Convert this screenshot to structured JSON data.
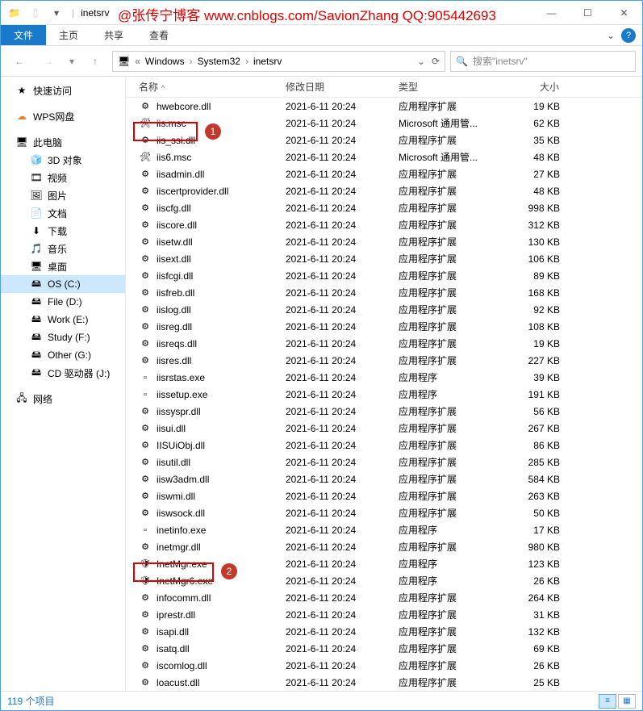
{
  "watermark": "@张传宁博客 www.cnblogs.com/SavionZhang  QQ:905442693",
  "window": {
    "title": "inetsrv"
  },
  "tabs": {
    "file": "文件",
    "home": "主页",
    "share": "共享",
    "view": "查看"
  },
  "breadcrumbs": [
    "Windows",
    "System32",
    "inetsrv"
  ],
  "search_placeholder": "搜索\"inetsrv\"",
  "columns": {
    "name": "名称",
    "date": "修改日期",
    "type": "类型",
    "size": "大小"
  },
  "sidebar": {
    "quick": "快速访问",
    "wps": "WPS网盘",
    "pc": "此电脑",
    "items": [
      {
        "icon": "🧊",
        "label": "3D 对象"
      },
      {
        "icon": "🎞",
        "label": "视频"
      },
      {
        "icon": "🖼",
        "label": "图片"
      },
      {
        "icon": "📄",
        "label": "文档"
      },
      {
        "icon": "⬇",
        "label": "下载"
      },
      {
        "icon": "🎵",
        "label": "音乐"
      },
      {
        "icon": "🖥",
        "label": "桌面"
      }
    ],
    "drives": [
      {
        "label": "OS (C:)",
        "sel": true
      },
      {
        "label": "File (D:)"
      },
      {
        "label": "Work (E:)"
      },
      {
        "label": "Study (F:)"
      },
      {
        "label": "Other (G:)"
      },
      {
        "label": "CD 驱动器 (J:)"
      }
    ],
    "network": "网络"
  },
  "files": [
    {
      "ico": "⚙",
      "name": "hwebcore.dll",
      "date": "2021-6-11 20:24",
      "type": "应用程序扩展",
      "size": "19 KB"
    },
    {
      "ico": "🛠",
      "name": "iis.msc",
      "date": "2021-6-11 20:24",
      "type": "Microsoft 通用管...",
      "size": "62 KB",
      "marker": 1
    },
    {
      "ico": "⚙",
      "name": "iis_ssi.dll",
      "date": "2021-6-11 20:24",
      "type": "应用程序扩展",
      "size": "35 KB"
    },
    {
      "ico": "🛠",
      "name": "iis6.msc",
      "date": "2021-6-11 20:24",
      "type": "Microsoft 通用管...",
      "size": "48 KB"
    },
    {
      "ico": "⚙",
      "name": "iisadmin.dll",
      "date": "2021-6-11 20:24",
      "type": "应用程序扩展",
      "size": "27 KB"
    },
    {
      "ico": "⚙",
      "name": "iiscertprovider.dll",
      "date": "2021-6-11 20:24",
      "type": "应用程序扩展",
      "size": "48 KB"
    },
    {
      "ico": "⚙",
      "name": "iiscfg.dll",
      "date": "2021-6-11 20:24",
      "type": "应用程序扩展",
      "size": "998 KB"
    },
    {
      "ico": "⚙",
      "name": "iiscore.dll",
      "date": "2021-6-11 20:24",
      "type": "应用程序扩展",
      "size": "312 KB"
    },
    {
      "ico": "⚙",
      "name": "iisetw.dll",
      "date": "2021-6-11 20:24",
      "type": "应用程序扩展",
      "size": "130 KB"
    },
    {
      "ico": "⚙",
      "name": "iisext.dll",
      "date": "2021-6-11 20:24",
      "type": "应用程序扩展",
      "size": "106 KB"
    },
    {
      "ico": "⚙",
      "name": "iisfcgi.dll",
      "date": "2021-6-11 20:24",
      "type": "应用程序扩展",
      "size": "89 KB"
    },
    {
      "ico": "⚙",
      "name": "iisfreb.dll",
      "date": "2021-6-11 20:24",
      "type": "应用程序扩展",
      "size": "168 KB"
    },
    {
      "ico": "⚙",
      "name": "iislog.dll",
      "date": "2021-6-11 20:24",
      "type": "应用程序扩展",
      "size": "92 KB"
    },
    {
      "ico": "⚙",
      "name": "iisreg.dll",
      "date": "2021-6-11 20:24",
      "type": "应用程序扩展",
      "size": "108 KB"
    },
    {
      "ico": "⚙",
      "name": "iisreqs.dll",
      "date": "2021-6-11 20:24",
      "type": "应用程序扩展",
      "size": "19 KB"
    },
    {
      "ico": "⚙",
      "name": "iisres.dll",
      "date": "2021-6-11 20:24",
      "type": "应用程序扩展",
      "size": "227 KB"
    },
    {
      "ico": "▫",
      "name": "iisrstas.exe",
      "date": "2021-6-11 20:24",
      "type": "应用程序",
      "size": "39 KB"
    },
    {
      "ico": "▫",
      "name": "iissetup.exe",
      "date": "2021-6-11 20:24",
      "type": "应用程序",
      "size": "191 KB"
    },
    {
      "ico": "⚙",
      "name": "iissyspr.dll",
      "date": "2021-6-11 20:24",
      "type": "应用程序扩展",
      "size": "56 KB"
    },
    {
      "ico": "⚙",
      "name": "iisui.dll",
      "date": "2021-6-11 20:24",
      "type": "应用程序扩展",
      "size": "267 KB"
    },
    {
      "ico": "⚙",
      "name": "IISUiObj.dll",
      "date": "2021-6-11 20:24",
      "type": "应用程序扩展",
      "size": "86 KB"
    },
    {
      "ico": "⚙",
      "name": "iisutil.dll",
      "date": "2021-6-11 20:24",
      "type": "应用程序扩展",
      "size": "285 KB"
    },
    {
      "ico": "⚙",
      "name": "iisw3adm.dll",
      "date": "2021-6-11 20:24",
      "type": "应用程序扩展",
      "size": "584 KB"
    },
    {
      "ico": "⚙",
      "name": "iiswmi.dll",
      "date": "2021-6-11 20:24",
      "type": "应用程序扩展",
      "size": "263 KB"
    },
    {
      "ico": "⚙",
      "name": "iiswsock.dll",
      "date": "2021-6-11 20:24",
      "type": "应用程序扩展",
      "size": "50 KB"
    },
    {
      "ico": "▫",
      "name": "inetinfo.exe",
      "date": "2021-6-11 20:24",
      "type": "应用程序",
      "size": "17 KB"
    },
    {
      "ico": "⚙",
      "name": "inetmgr.dll",
      "date": "2021-6-11 20:24",
      "type": "应用程序扩展",
      "size": "980 KB"
    },
    {
      "ico": "🛡",
      "name": "InetMgr.exe",
      "date": "2021-6-11 20:24",
      "type": "应用程序",
      "size": "123 KB",
      "marker": 2
    },
    {
      "ico": "🛡",
      "name": "InetMgr6.exe",
      "date": "2021-6-11 20:24",
      "type": "应用程序",
      "size": "26 KB"
    },
    {
      "ico": "⚙",
      "name": "infocomm.dll",
      "date": "2021-6-11 20:24",
      "type": "应用程序扩展",
      "size": "264 KB"
    },
    {
      "ico": "⚙",
      "name": "iprestr.dll",
      "date": "2021-6-11 20:24",
      "type": "应用程序扩展",
      "size": "31 KB"
    },
    {
      "ico": "⚙",
      "name": "isapi.dll",
      "date": "2021-6-11 20:24",
      "type": "应用程序扩展",
      "size": "132 KB"
    },
    {
      "ico": "⚙",
      "name": "isatq.dll",
      "date": "2021-6-11 20:24",
      "type": "应用程序扩展",
      "size": "69 KB"
    },
    {
      "ico": "⚙",
      "name": "iscomlog.dll",
      "date": "2021-6-11 20:24",
      "type": "应用程序扩展",
      "size": "26 KB"
    },
    {
      "ico": "⚙",
      "name": "loacust.dll",
      "date": "2021-6-11 20:24",
      "type": "应用程序扩展",
      "size": "25 KB"
    }
  ],
  "status": {
    "count": "119 个项目"
  },
  "markers": {
    "1": "1",
    "2": "2"
  }
}
